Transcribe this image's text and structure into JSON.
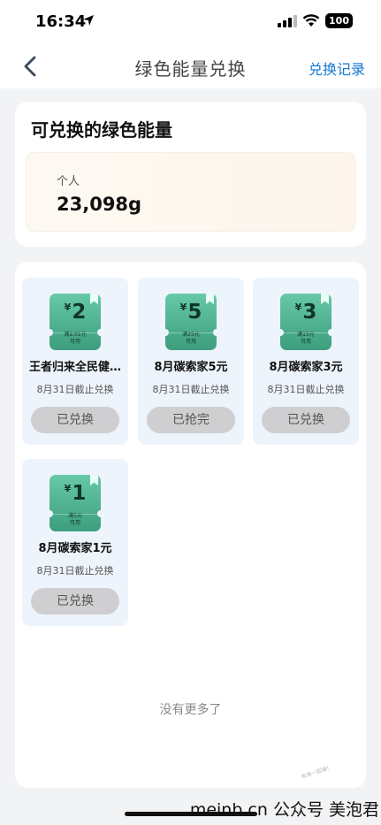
{
  "status_bar": {
    "time": "16:34",
    "battery": "100"
  },
  "nav": {
    "title": "绿色能量兑换",
    "action": "兑换记录"
  },
  "energy": {
    "title": "可兑换的绿色能量",
    "label": "个人",
    "value": "23,098g"
  },
  "coupons": [
    {
      "currency": "¥",
      "amount": "2",
      "condition_line1": "满2.01元",
      "condition_line2": "可用",
      "name": "王者归来全民健…",
      "deadline": "8月31日截止兑换",
      "button": "已兑换"
    },
    {
      "currency": "¥",
      "amount": "5",
      "condition_line1": "满25元",
      "condition_line2": "可用",
      "name": "8月碳索家5元",
      "deadline": "8月31日截止兑换",
      "button": "已抢完"
    },
    {
      "currency": "¥",
      "amount": "3",
      "condition_line1": "满15元",
      "condition_line2": "可用",
      "name": "8月碳索家3元",
      "deadline": "8月31日截止兑换",
      "button": "已兑换"
    },
    {
      "currency": "¥",
      "amount": "1",
      "condition_line1": "满5元",
      "condition_line2": "可用",
      "name": "8月碳索家1元",
      "deadline": "8月31日截止兑换",
      "button": "已兑换"
    }
  ],
  "footer": {
    "no_more": "没有更多了",
    "watermark_small": "有美一起赚！",
    "watermark": "meinb.cn 公众号 美泡君"
  },
  "colors": {
    "accent_link": "#1677d2",
    "ticket_green": "#4fb592",
    "card_bg": "#eef4fc",
    "disabled_button": "#cfcfd1"
  },
  "icons": [
    "location-arrow-icon",
    "cellular-signal-icon",
    "wifi-icon",
    "battery-icon",
    "back-chevron-icon",
    "bookmark-icon"
  ]
}
